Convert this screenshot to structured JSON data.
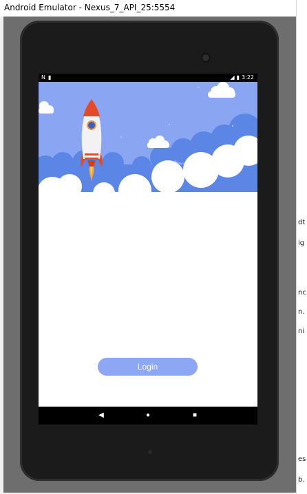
{
  "window": {
    "title": "Android Emulator - Nexus_7_API_25:5554"
  },
  "statusbar": {
    "left_icons": [
      "notification-icon",
      "sd-card-icon"
    ],
    "time": "3:22",
    "right_icons": [
      "signal-icon",
      "battery-icon"
    ]
  },
  "app": {
    "login_label": "Login"
  },
  "colors": {
    "sky": "#8aa6f3",
    "cloud_back": "#5b86e5",
    "button": "#8ea7f5",
    "rocket_body": "#f2f2f2",
    "rocket_red": "#e44a2a"
  },
  "navbar": {
    "back": "◀",
    "home": "●",
    "recents": "■"
  },
  "sidepanel": {
    "fragments": [
      "dt",
      "ig",
      "nc",
      "n.",
      "ni",
      "es",
      "b."
    ]
  }
}
